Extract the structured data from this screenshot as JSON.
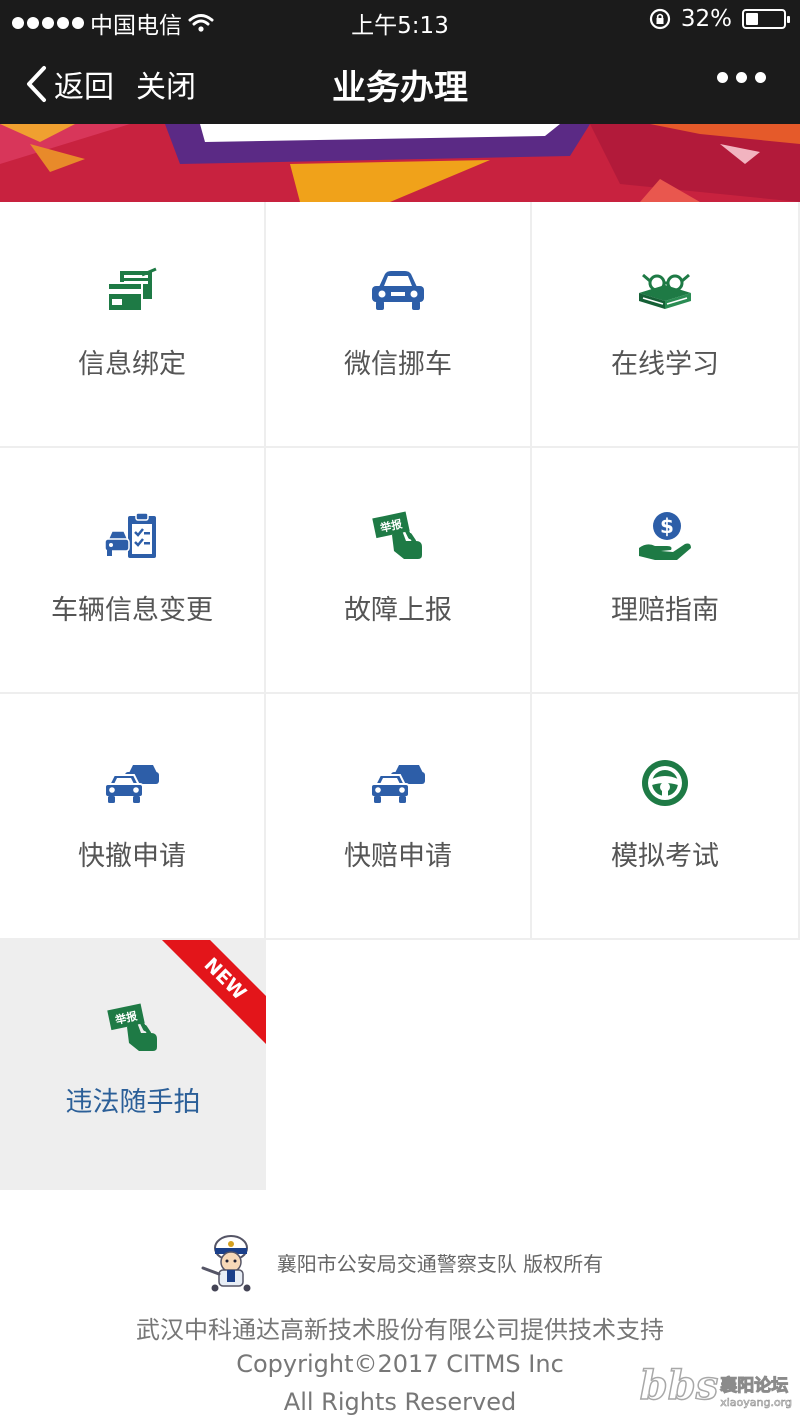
{
  "status_bar": {
    "carrier": "中国电信",
    "time": "上午5:13",
    "battery_percent": "32%",
    "battery_level": 0.32
  },
  "nav": {
    "back_label": "返回",
    "close_label": "关闭",
    "title": "业务办理"
  },
  "colors": {
    "nav_bg": "#1b1b1b",
    "icon_green": "#1e7a45",
    "icon_blue": "#2d5ea8",
    "new_ribbon": "#e3151a",
    "banner_red": "#c8223f"
  },
  "grid": {
    "items": [
      {
        "label": "信息绑定",
        "icon": "card-binding-icon"
      },
      {
        "label": "微信挪车",
        "icon": "car-icon"
      },
      {
        "label": "在线学习",
        "icon": "book-glasses-icon"
      },
      {
        "label": "车辆信息变更",
        "icon": "car-clipboard-icon"
      },
      {
        "label": "故障上报",
        "icon": "hand-report-icon"
      },
      {
        "label": "理赔指南",
        "icon": "hand-dollar-icon"
      },
      {
        "label": "快撤申请",
        "icon": "two-cars-icon"
      },
      {
        "label": "快赔申请",
        "icon": "two-cars-icon"
      },
      {
        "label": "模拟考试",
        "icon": "steering-wheel-icon"
      },
      {
        "label": "违法随手拍",
        "icon": "hand-report-icon",
        "badge": "NEW"
      }
    ],
    "report_sign_text": "举报"
  },
  "footer": {
    "owner": "襄阳市公安局交通警察支队 版权所有",
    "support": "武汉中科通达高新技术股份有限公司提供技术支持",
    "copyright": "Copyright©2017 CITMS Inc",
    "rights": "All Rights Reserved"
  },
  "watermark": {
    "bbs": "bbs",
    "site_name": "襄阳论坛",
    "url": "xiaoyang.org"
  }
}
